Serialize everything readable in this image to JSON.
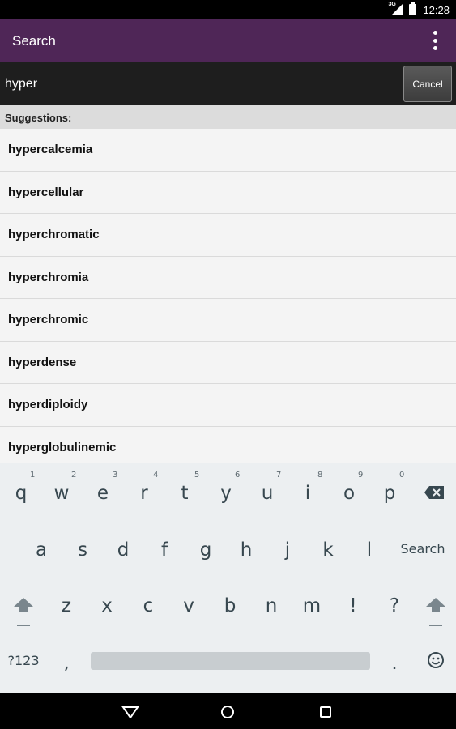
{
  "status_bar": {
    "network": "3G",
    "time": "12:28"
  },
  "app_bar": {
    "title": "Search",
    "menu_icon": "overflow-menu-icon"
  },
  "search": {
    "query": "hyper",
    "cancel_label": "Cancel"
  },
  "suggestions": {
    "header": "Suggestions:",
    "items": [
      "hypercalcemia",
      "hypercellular",
      "hyperchromatic",
      "hyperchromia",
      "hyperchromic",
      "hyperdense",
      "hyperdiploidy",
      "hyperglobulinemic"
    ]
  },
  "keyboard": {
    "row1": [
      "q",
      "w",
      "e",
      "r",
      "t",
      "y",
      "u",
      "i",
      "o",
      "p"
    ],
    "row1_hints": [
      "1",
      "2",
      "3",
      "4",
      "5",
      "6",
      "7",
      "8",
      "9",
      "0"
    ],
    "row2": [
      "a",
      "s",
      "d",
      "f",
      "g",
      "h",
      "j",
      "k",
      "l"
    ],
    "row2_action": "Search",
    "row3": [
      "z",
      "x",
      "c",
      "v",
      "b",
      "n",
      "m",
      "!",
      "?"
    ],
    "row4_symbols": "?123",
    "row4_comma": ",",
    "row4_period": "."
  },
  "colors": {
    "app_bar": "#4f2657",
    "search_bar": "#1e1e1e"
  }
}
